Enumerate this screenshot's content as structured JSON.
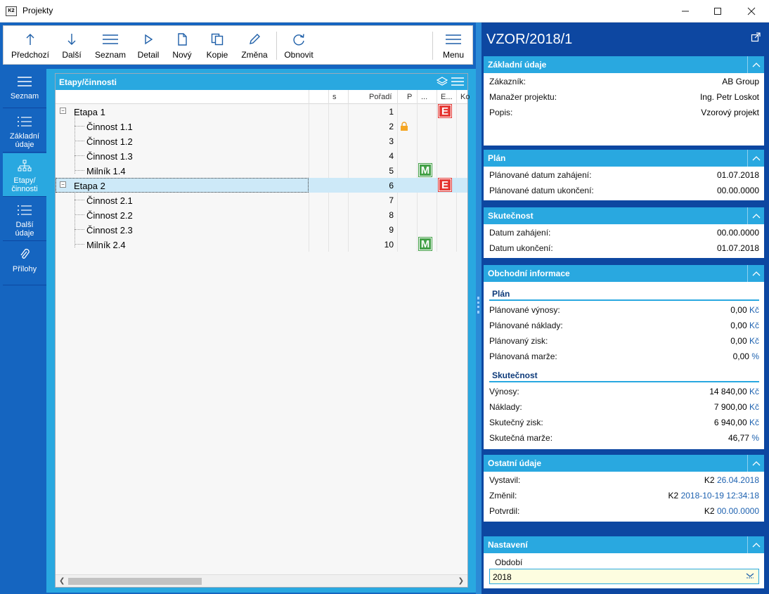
{
  "window": {
    "title": "Projekty",
    "app_icon_text": "K2"
  },
  "toolbar": {
    "previous": "Předchozí",
    "next": "Další",
    "list": "Seznam",
    "detail": "Detail",
    "new": "Nový",
    "copy": "Kopie",
    "change": "Změna",
    "refresh": "Obnovit",
    "menu": "Menu"
  },
  "nav": {
    "list": "Seznam",
    "basic_line1": "Základní",
    "basic_line2": "údaje",
    "stages_line1": "Etapy/",
    "stages_line2": "činnosti",
    "other_line1": "Další",
    "other_line2": "údaje",
    "attachments": "Přílohy"
  },
  "grid": {
    "title": "Etapy/činnosti",
    "columns": {
      "s": "s",
      "order": "Pořadí",
      "p": "P",
      "dots": "...",
      "e": "E...",
      "k": "Ko"
    },
    "rows": [
      {
        "name": "Etapa 1",
        "order": "1",
        "level": 0,
        "toggle": "−",
        "badge": "E"
      },
      {
        "name": "Činnost 1.1",
        "order": "2",
        "level": 1,
        "lock": true
      },
      {
        "name": "Činnost 1.2",
        "order": "3",
        "level": 1
      },
      {
        "name": "Činnost 1.3",
        "order": "4",
        "level": 1
      },
      {
        "name": "Milník 1.4",
        "order": "5",
        "level": 1,
        "badge": "M"
      },
      {
        "name": "Etapa 2",
        "order": "6",
        "level": 0,
        "toggle": "−",
        "badge": "E",
        "selected": true
      },
      {
        "name": "Činnost 2.1",
        "order": "7",
        "level": 1
      },
      {
        "name": "Činnost 2.2",
        "order": "8",
        "level": 1
      },
      {
        "name": "Činnost 2.3",
        "order": "9",
        "level": 1
      },
      {
        "name": "Milník 2.4",
        "order": "10",
        "level": 1,
        "badge": "M"
      }
    ]
  },
  "detail": {
    "code": "VZOR/2018/1",
    "basic": {
      "title": "Základní údaje",
      "customer_label": "Zákazník:",
      "customer": "AB Group",
      "manager_label": "Manažer projektu:",
      "manager": "Ing. Petr Loskot",
      "description_label": "Popis:",
      "description": "Vzorový projekt"
    },
    "plan": {
      "title": "Plán",
      "start_label": "Plánované datum zahájení:",
      "start": "01.07.2018",
      "end_label": "Plánované datum ukončení:",
      "end": "00.00.0000"
    },
    "actual": {
      "title": "Skutečnost",
      "start_label": "Datum zahájení:",
      "start": "00.00.0000",
      "end_label": "Datum ukončení:",
      "end": "01.07.2018"
    },
    "business": {
      "title": "Obchodní informace",
      "plan_heading": "Plán",
      "planned_revenue_label": "Plánované výnosy:",
      "planned_revenue": "0,00",
      "planned_costs_label": "Plánované náklady:",
      "planned_costs": "0,00",
      "planned_profit_label": "Plánovaný zisk:",
      "planned_profit": "0,00",
      "planned_margin_label": "Plánovaná marže:",
      "planned_margin": "0,00",
      "actual_heading": "Skutečnost",
      "revenue_label": "Výnosy:",
      "revenue": "14 840,00",
      "costs_label": "Náklady:",
      "costs": "7 900,00",
      "profit_label": "Skutečný zisk:",
      "profit": "6 940,00",
      "margin_label": "Skutečná marže:",
      "margin": "46,77",
      "currency": "Kč",
      "percent": "%"
    },
    "other": {
      "title": "Ostatní údaje",
      "issued_label": "Vystavil:",
      "issued_user": "K2",
      "issued_date": "26.04.2018",
      "changed_label": "Změnil:",
      "changed_user": "K2",
      "changed_date": "2018-10-19 12:34:18",
      "confirmed_label": "Potvrdil:",
      "confirmed_user": "K2",
      "confirmed_date": "00.00.0000"
    },
    "settings": {
      "title": "Nastavení",
      "period_label": "Období",
      "period_value": "2018"
    }
  }
}
